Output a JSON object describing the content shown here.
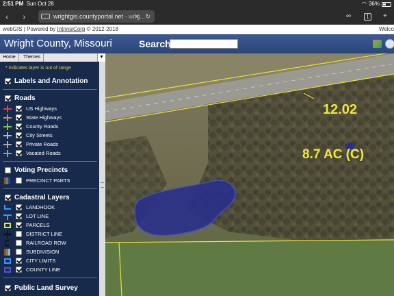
{
  "status": {
    "time": "2:51 PM",
    "date": "Sun Oct 28",
    "battery": "36%"
  },
  "browser": {
    "url_host": "wrightgis.countyportal.net",
    "url_rest": " - wrig...",
    "tab_count": "1"
  },
  "gisbar": {
    "app": "webGIS",
    "powered_prefix": "|   Powered by",
    "vendor": "IntrinsiCorp",
    "copyright": "©  2012-2018",
    "welcome": "Welco"
  },
  "header": {
    "title": "Wright County, Missouri",
    "search_label": "Search:",
    "search_value": ""
  },
  "sidebar": {
    "tabs": [
      "Home",
      "Themes"
    ],
    "note": "* indicates layer is out of range",
    "groups": {
      "labels": "Labels and Annotation",
      "roads": "Roads",
      "voting": "Voting Precincts",
      "cadastral": "Cadastral Layers",
      "pls": "Public Land Survey"
    },
    "items": {
      "us_highways": "US Highways",
      "state_highways": "State Highways",
      "county_roads": "County Roads",
      "city_streets": "City Streets",
      "private_roads": "Private Roads",
      "vacated_roads": "Vacated Roads",
      "precinct_parts": "PRECINCT PARTS",
      "landhook": "LANDHOOK",
      "lot_line": "LOT LINE",
      "parcels": "PARCELS",
      "district_line": "DISTRICT LINE",
      "railroad_row": "RAILROAD ROW",
      "subdivision": "SUBDIVISION",
      "city_limits": "CITY LIMITS",
      "county_line": "COUNTY LINE"
    }
  },
  "map": {
    "label_number": "12.02",
    "label_acreage": "8.7 AC (C)",
    "label_color": "#f3e63b",
    "parcel_line_color": "#e8e33a",
    "water_color": "#2a2f8a"
  },
  "icons": [
    "back-icon",
    "forward-icon",
    "site-icon",
    "close-icon",
    "reload-icon",
    "reader-icon",
    "tabs-icon",
    "layers-icon",
    "globe-icon"
  ]
}
